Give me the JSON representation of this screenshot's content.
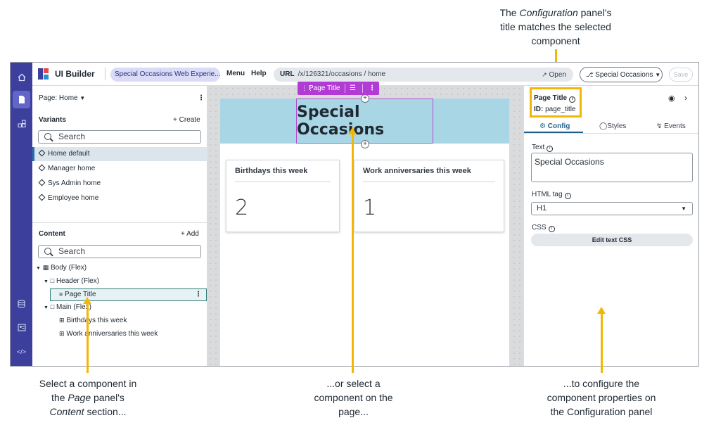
{
  "callouts": {
    "top_pre": "The ",
    "top_em": "Configuration",
    "top_post": " panel's",
    "top_line2": "title matches the selected",
    "top_line3": "component",
    "left_line1": "Select a component in",
    "left_line2_pre": "the ",
    "left_line2_em": "Page",
    "left_line2_post": " panel's",
    "left_line3_em": "Content",
    "left_line3_post": " section...",
    "mid_line1": "...or select a",
    "mid_line2": "component on the",
    "mid_line3": "page...",
    "right_line1": "...to configure the",
    "right_line2": "component properties on",
    "right_line3": "the Configuration panel"
  },
  "topbar": {
    "app_title": "UI Builder",
    "experience": "Special Occasions Web Experie...",
    "menu": "Menu",
    "help": "Help",
    "url_label": "URL",
    "url_path": "/x/126321/occasions / home",
    "open": "Open",
    "page_select": "Special Occasions",
    "save": "Save"
  },
  "left_panel": {
    "page_label": "Page: Home",
    "variants_title": "Variants",
    "create": "+ Create",
    "search_placeholder": "Search",
    "variants": [
      "Home default",
      "Manager home",
      "Sys Admin home",
      "Employee home"
    ],
    "content_title": "Content",
    "add": "+ Add",
    "tree": {
      "body": "Body (Flex)",
      "header": "Header (Flex)",
      "page_title": "Page Title",
      "main": "Main (Flex)",
      "birthdays": "Birthdays this week",
      "anniversaries": "Work anniversaries this week"
    }
  },
  "canvas": {
    "toolbar_label": "Page Title",
    "hero_title": "Special Occasions",
    "cards": [
      {
        "title": "Birthdays this week",
        "value": "2"
      },
      {
        "title": "Work anniversaries this week",
        "value": "1"
      }
    ]
  },
  "right_panel": {
    "title": "Page Title",
    "id_label": "ID:",
    "id_value": "page_title",
    "tabs": [
      "Config",
      "Styles",
      "Events"
    ],
    "text_label": "Text",
    "text_value": "Special Occasions",
    "html_tag_label": "HTML tag",
    "html_tag_value": "H1",
    "css_label": "CSS",
    "edit_css": "Edit text CSS"
  },
  "colors": {
    "rail": "#3c3f9c",
    "accent_highlight": "#f2b705",
    "selection_magenta": "#b23bd6",
    "hero_bg": "#a9d6e5"
  }
}
